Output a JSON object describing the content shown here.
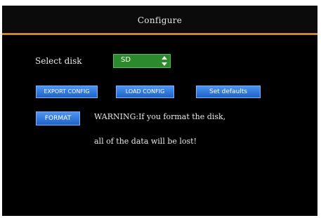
{
  "window": {
    "title": "Configure"
  },
  "disk": {
    "label": "Select disk",
    "selected": "SD"
  },
  "buttons": {
    "export": "EXPORT CONFIG",
    "load": "LOAD CONFIG",
    "defaults": "Set defaults",
    "format": "FORMAT"
  },
  "warning": {
    "line1": "WARNING:If you format the disk,",
    "line2": "all of the data will be lost!"
  },
  "colors": {
    "accent_rule": "#c98a2a",
    "button_blue": "#2f79e0",
    "select_green": "#2c8a2c"
  },
  "icons": {
    "disk_spinner": "up-down-arrows-icon"
  }
}
